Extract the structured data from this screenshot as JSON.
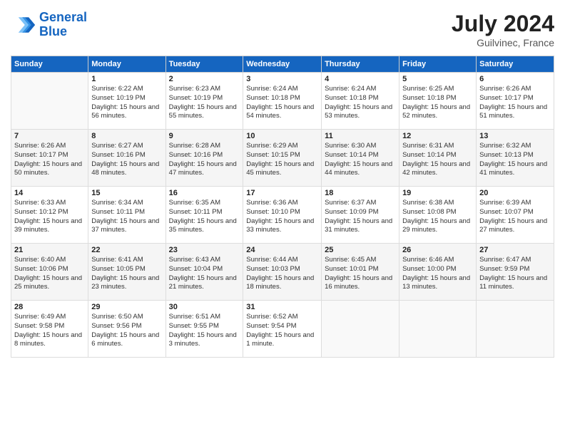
{
  "header": {
    "logo_line1": "General",
    "logo_line2": "Blue",
    "month_year": "July 2024",
    "location": "Guilvinec, France"
  },
  "weekdays": [
    "Sunday",
    "Monday",
    "Tuesday",
    "Wednesday",
    "Thursday",
    "Friday",
    "Saturday"
  ],
  "weeks": [
    [
      {
        "day": "",
        "sunrise": "",
        "sunset": "",
        "daylight": ""
      },
      {
        "day": "1",
        "sunrise": "Sunrise: 6:22 AM",
        "sunset": "Sunset: 10:19 PM",
        "daylight": "Daylight: 15 hours and 56 minutes."
      },
      {
        "day": "2",
        "sunrise": "Sunrise: 6:23 AM",
        "sunset": "Sunset: 10:19 PM",
        "daylight": "Daylight: 15 hours and 55 minutes."
      },
      {
        "day": "3",
        "sunrise": "Sunrise: 6:24 AM",
        "sunset": "Sunset: 10:18 PM",
        "daylight": "Daylight: 15 hours and 54 minutes."
      },
      {
        "day": "4",
        "sunrise": "Sunrise: 6:24 AM",
        "sunset": "Sunset: 10:18 PM",
        "daylight": "Daylight: 15 hours and 53 minutes."
      },
      {
        "day": "5",
        "sunrise": "Sunrise: 6:25 AM",
        "sunset": "Sunset: 10:18 PM",
        "daylight": "Daylight: 15 hours and 52 minutes."
      },
      {
        "day": "6",
        "sunrise": "Sunrise: 6:26 AM",
        "sunset": "Sunset: 10:17 PM",
        "daylight": "Daylight: 15 hours and 51 minutes."
      }
    ],
    [
      {
        "day": "7",
        "sunrise": "Sunrise: 6:26 AM",
        "sunset": "Sunset: 10:17 PM",
        "daylight": "Daylight: 15 hours and 50 minutes."
      },
      {
        "day": "8",
        "sunrise": "Sunrise: 6:27 AM",
        "sunset": "Sunset: 10:16 PM",
        "daylight": "Daylight: 15 hours and 48 minutes."
      },
      {
        "day": "9",
        "sunrise": "Sunrise: 6:28 AM",
        "sunset": "Sunset: 10:16 PM",
        "daylight": "Daylight: 15 hours and 47 minutes."
      },
      {
        "day": "10",
        "sunrise": "Sunrise: 6:29 AM",
        "sunset": "Sunset: 10:15 PM",
        "daylight": "Daylight: 15 hours and 45 minutes."
      },
      {
        "day": "11",
        "sunrise": "Sunrise: 6:30 AM",
        "sunset": "Sunset: 10:14 PM",
        "daylight": "Daylight: 15 hours and 44 minutes."
      },
      {
        "day": "12",
        "sunrise": "Sunrise: 6:31 AM",
        "sunset": "Sunset: 10:14 PM",
        "daylight": "Daylight: 15 hours and 42 minutes."
      },
      {
        "day": "13",
        "sunrise": "Sunrise: 6:32 AM",
        "sunset": "Sunset: 10:13 PM",
        "daylight": "Daylight: 15 hours and 41 minutes."
      }
    ],
    [
      {
        "day": "14",
        "sunrise": "Sunrise: 6:33 AM",
        "sunset": "Sunset: 10:12 PM",
        "daylight": "Daylight: 15 hours and 39 minutes."
      },
      {
        "day": "15",
        "sunrise": "Sunrise: 6:34 AM",
        "sunset": "Sunset: 10:11 PM",
        "daylight": "Daylight: 15 hours and 37 minutes."
      },
      {
        "day": "16",
        "sunrise": "Sunrise: 6:35 AM",
        "sunset": "Sunset: 10:11 PM",
        "daylight": "Daylight: 15 hours and 35 minutes."
      },
      {
        "day": "17",
        "sunrise": "Sunrise: 6:36 AM",
        "sunset": "Sunset: 10:10 PM",
        "daylight": "Daylight: 15 hours and 33 minutes."
      },
      {
        "day": "18",
        "sunrise": "Sunrise: 6:37 AM",
        "sunset": "Sunset: 10:09 PM",
        "daylight": "Daylight: 15 hours and 31 minutes."
      },
      {
        "day": "19",
        "sunrise": "Sunrise: 6:38 AM",
        "sunset": "Sunset: 10:08 PM",
        "daylight": "Daylight: 15 hours and 29 minutes."
      },
      {
        "day": "20",
        "sunrise": "Sunrise: 6:39 AM",
        "sunset": "Sunset: 10:07 PM",
        "daylight": "Daylight: 15 hours and 27 minutes."
      }
    ],
    [
      {
        "day": "21",
        "sunrise": "Sunrise: 6:40 AM",
        "sunset": "Sunset: 10:06 PM",
        "daylight": "Daylight: 15 hours and 25 minutes."
      },
      {
        "day": "22",
        "sunrise": "Sunrise: 6:41 AM",
        "sunset": "Sunset: 10:05 PM",
        "daylight": "Daylight: 15 hours and 23 minutes."
      },
      {
        "day": "23",
        "sunrise": "Sunrise: 6:43 AM",
        "sunset": "Sunset: 10:04 PM",
        "daylight": "Daylight: 15 hours and 21 minutes."
      },
      {
        "day": "24",
        "sunrise": "Sunrise: 6:44 AM",
        "sunset": "Sunset: 10:03 PM",
        "daylight": "Daylight: 15 hours and 18 minutes."
      },
      {
        "day": "25",
        "sunrise": "Sunrise: 6:45 AM",
        "sunset": "Sunset: 10:01 PM",
        "daylight": "Daylight: 15 hours and 16 minutes."
      },
      {
        "day": "26",
        "sunrise": "Sunrise: 6:46 AM",
        "sunset": "Sunset: 10:00 PM",
        "daylight": "Daylight: 15 hours and 13 minutes."
      },
      {
        "day": "27",
        "sunrise": "Sunrise: 6:47 AM",
        "sunset": "Sunset: 9:59 PM",
        "daylight": "Daylight: 15 hours and 11 minutes."
      }
    ],
    [
      {
        "day": "28",
        "sunrise": "Sunrise: 6:49 AM",
        "sunset": "Sunset: 9:58 PM",
        "daylight": "Daylight: 15 hours and 8 minutes."
      },
      {
        "day": "29",
        "sunrise": "Sunrise: 6:50 AM",
        "sunset": "Sunset: 9:56 PM",
        "daylight": "Daylight: 15 hours and 6 minutes."
      },
      {
        "day": "30",
        "sunrise": "Sunrise: 6:51 AM",
        "sunset": "Sunset: 9:55 PM",
        "daylight": "Daylight: 15 hours and 3 minutes."
      },
      {
        "day": "31",
        "sunrise": "Sunrise: 6:52 AM",
        "sunset": "Sunset: 9:54 PM",
        "daylight": "Daylight: 15 hours and 1 minute."
      },
      {
        "day": "",
        "sunrise": "",
        "sunset": "",
        "daylight": ""
      },
      {
        "day": "",
        "sunrise": "",
        "sunset": "",
        "daylight": ""
      },
      {
        "day": "",
        "sunrise": "",
        "sunset": "",
        "daylight": ""
      }
    ]
  ]
}
